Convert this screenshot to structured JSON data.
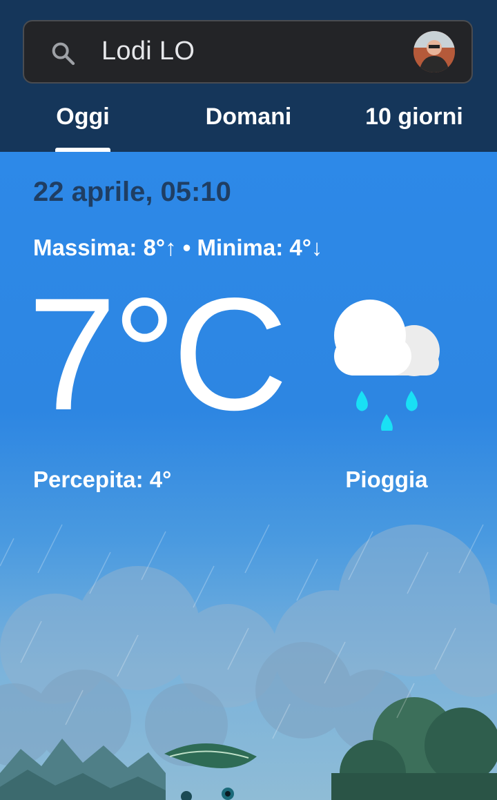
{
  "search": {
    "value": "Lodi LO"
  },
  "tabs": [
    {
      "label": "Oggi",
      "active": true
    },
    {
      "label": "Domani",
      "active": false
    },
    {
      "label": "10 giorni",
      "active": false
    }
  ],
  "weather": {
    "date_time": "22 aprile, 05:10",
    "min_max": "Massima: 8°↑ • Minima: 4°↓",
    "temperature": "7°C",
    "feels_like": "Percepita: 4°",
    "condition": "Pioggia",
    "condition_icon": "rain-cloud-icon"
  },
  "colors": {
    "topbar": "#15365a",
    "sky": "#2d89e8",
    "rain_drop": "#19e0f5"
  }
}
